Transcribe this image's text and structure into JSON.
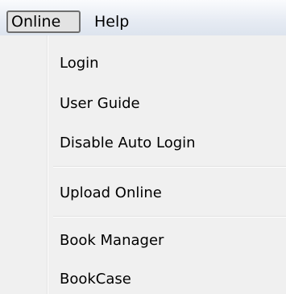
{
  "menubar": {
    "items": [
      "Online",
      "Help"
    ]
  },
  "menu": {
    "items": [
      "Login",
      "User Guide",
      "Disable Auto Login",
      "Upload Online",
      "Book Manager",
      "BookCase"
    ]
  }
}
